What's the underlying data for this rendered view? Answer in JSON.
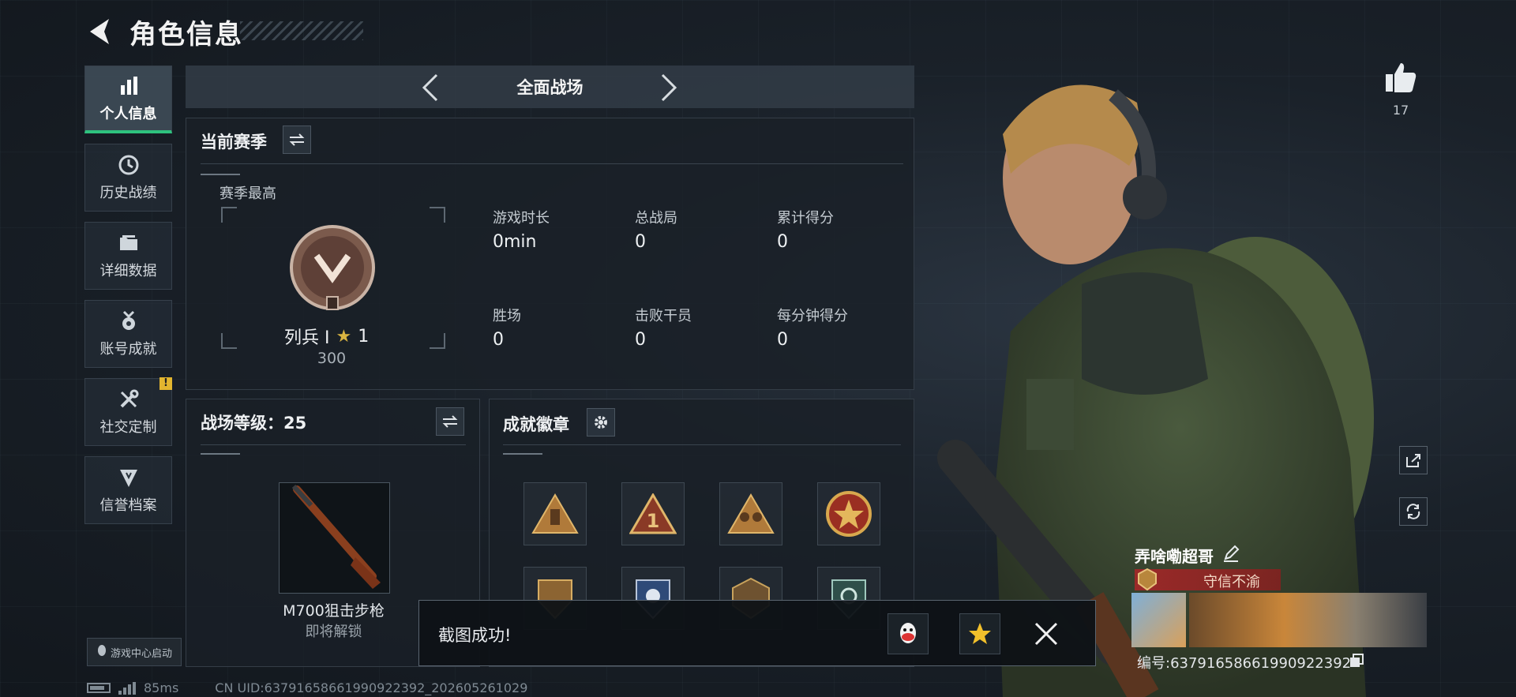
{
  "header": {
    "title": "角色信息"
  },
  "nav": {
    "items": [
      {
        "label": "个人信息",
        "icon": "bar-chart-icon",
        "active": true
      },
      {
        "label": "历史战绩",
        "icon": "history-clock-icon"
      },
      {
        "label": "详细数据",
        "icon": "folder-icon"
      },
      {
        "label": "账号成就",
        "icon": "achievement-medal-icon"
      },
      {
        "label": "社交定制",
        "icon": "wrench-screwdriver-icon",
        "alert": "!"
      },
      {
        "label": "信誉档案",
        "icon": "credit-shield-icon"
      }
    ],
    "game_center_label": "游戏中心启动"
  },
  "mode": {
    "title": "全面战场"
  },
  "season": {
    "title": "当前赛季",
    "best_label": "赛季最高",
    "rank_name": "列兵 Ⅰ",
    "rank_stars": "1",
    "rank_points": "300",
    "stats": [
      {
        "label": "游戏时长",
        "value": "0min"
      },
      {
        "label": "总战局",
        "value": "0"
      },
      {
        "label": "累计得分",
        "value": "0"
      },
      {
        "label": "胜场",
        "value": "0"
      },
      {
        "label": "击败干员",
        "value": "0"
      },
      {
        "label": "每分钟得分",
        "value": "0"
      }
    ]
  },
  "battle_level": {
    "title": "战场等级：25",
    "weapon_name": "M700狙击步枪",
    "weapon_status": "即将解锁"
  },
  "achievements": {
    "title": "成就徽章",
    "badges": [
      "badge-tower",
      "badge-number-one",
      "badge-soldiers",
      "badge-star-medal",
      "badge-shield-a",
      "badge-shield-b",
      "badge-shield-c",
      "badge-shield-d"
    ]
  },
  "toast": {
    "message": "截图成功!"
  },
  "footer": {
    "ping": "85ms",
    "uid": "CN UID:63791658661990922392_202605261029"
  },
  "profile": {
    "likes": "17",
    "player_name": "弄啥嘞超哥",
    "player_title": "守信不渝",
    "player_id": "编号:63791658661990922392"
  },
  "colors": {
    "accent_green": "#2ec27e",
    "title_red": "#a02828",
    "alert_yellow": "#e2b52f"
  }
}
